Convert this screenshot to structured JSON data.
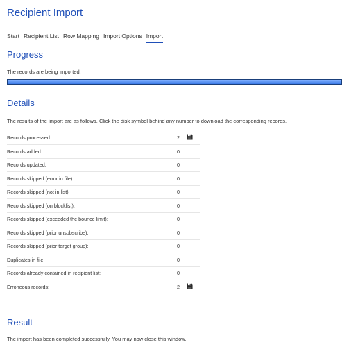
{
  "header": {
    "title": "Recipient Import"
  },
  "tabs": [
    {
      "label": "Start",
      "active": false
    },
    {
      "label": "Recipient List",
      "active": false
    },
    {
      "label": "Row Mapping",
      "active": false
    },
    {
      "label": "Import Options",
      "active": false
    },
    {
      "label": "Import",
      "active": true
    }
  ],
  "progress": {
    "heading": "Progress",
    "status_text": "The records are being imported:",
    "fraction": 1.0
  },
  "details": {
    "heading": "Details",
    "intro": "The results of the import are as follows. Click the disk symbol behind any number to download the corresponding records.",
    "rows": [
      {
        "label": "Records processed:",
        "value": "2",
        "download_icon": "disk-icon"
      },
      {
        "label": "Records added:",
        "value": "0"
      },
      {
        "label": "Records updated:",
        "value": "0"
      },
      {
        "label": "Records skipped (error in file):",
        "value": "0"
      },
      {
        "label": "Records skipped (not in list):",
        "value": "0"
      },
      {
        "label": "Records skipped (on blocklist):",
        "value": "0"
      },
      {
        "label": "Records skipped (exceeded the bounce limit):",
        "value": "0"
      },
      {
        "label": "Records skipped (prior unsubscribe):",
        "value": "0"
      },
      {
        "label": "Records skipped (prior target group):",
        "value": "0"
      },
      {
        "label": "Duplicates in file:",
        "value": "0"
      },
      {
        "label": "Records already contained in recipient list:",
        "value": "0"
      },
      {
        "label": "Erroneous records:",
        "value": "2",
        "download_icon": "disk-icon"
      }
    ]
  },
  "result": {
    "heading": "Result",
    "message": "The import has been completed successfully. You may now close this window."
  },
  "colors": {
    "accent": "#1f4fb8",
    "progress_fill": "#3b7ae6",
    "progress_border": "#1a3f7a"
  }
}
